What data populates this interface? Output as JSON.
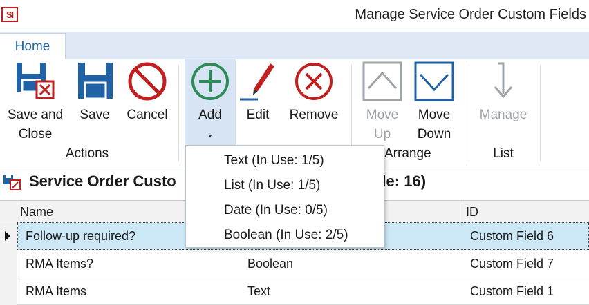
{
  "window": {
    "logo_text": "SI",
    "title": "Manage Service Order Custom Fields"
  },
  "tabs": [
    {
      "label": "Home"
    }
  ],
  "ribbon": {
    "actions": {
      "save_close_label_line1": "Save and",
      "save_close_label_line2": "Close",
      "save_label": "Save",
      "cancel_label": "Cancel",
      "group_label": "Actions"
    },
    "edit_group": {
      "add_label": "Add",
      "edit_label": "Edit",
      "remove_label": "Remove"
    },
    "arrange": {
      "move_up_line1": "Move",
      "move_up_line2": "Up",
      "move_down_line1": "Move",
      "move_down_line2": "Down",
      "group_label": "Arrange"
    },
    "list": {
      "manage_label": "Manage",
      "group_label": "List"
    }
  },
  "add_menu": {
    "items": [
      {
        "label": "Text (In Use: 1/5)"
      },
      {
        "label": "List (In Use: 1/5)"
      },
      {
        "label": "Date (In Use: 0/5)"
      },
      {
        "label": "Boolean (In Use: 2/5)"
      }
    ]
  },
  "section": {
    "title_visible_start": "Service Order Custo",
    "title_visible_end": "ble: 16)"
  },
  "grid": {
    "columns": [
      "Name",
      "",
      "ID"
    ],
    "rows": [
      {
        "name": "Follow-up required?",
        "type": "",
        "id": "Custom Field 6",
        "selected": true
      },
      {
        "name": "RMA Items?",
        "type": "Boolean",
        "id": "Custom Field 7",
        "selected": false
      },
      {
        "name": "RMA Items",
        "type": "Text",
        "id": "Custom Field 1",
        "selected": false
      }
    ]
  },
  "colors": {
    "accent": "#1f63a6",
    "tab_strip": "#dfe9f5",
    "selected_row": "#cce8f6",
    "cancel_red": "#c0201f",
    "add_green": "#2e8b57",
    "disabled_gray": "#9ea3a8"
  }
}
